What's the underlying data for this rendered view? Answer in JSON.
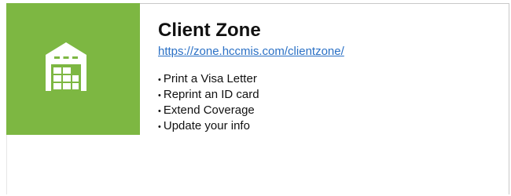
{
  "card": {
    "title": "Client Zone",
    "url": "https://zone.hccmis.com/clientzone/",
    "icon": "warehouse-icon",
    "tile_color": "#7db742",
    "link_color": "#2a70c5",
    "items": [
      {
        "label": "Print a Visa Letter"
      },
      {
        "label": "Reprint an ID card"
      },
      {
        "label": "Extend Coverage"
      },
      {
        "label": "Update your info"
      }
    ]
  }
}
